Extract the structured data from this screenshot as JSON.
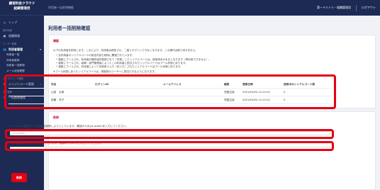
{
  "app": {
    "brand_line1": "顧客料金クラウド",
    "brand_line2": "組織管理用"
  },
  "topbar": {
    "breadcrumb": "利用者一括削除機能",
    "org_name": "第一ドミトリ・組織管理用",
    "logout": "ログアウト"
  },
  "sidebar": {
    "top": {
      "icon": "home-icon",
      "label": "トップ"
    },
    "section_basic": "基本情報",
    "basic_info": {
      "icon": "building-icon",
      "label": "組織情報"
    },
    "section_user": "ユーザー管理",
    "user_manage": {
      "icon": "users-icon",
      "label": "利用者管理"
    },
    "sub_items": [
      "利用者一覧",
      "利用者登録",
      "利用者一括登録",
      "メール送信履歴"
    ],
    "section_serial": "シリアルコード管理",
    "serial": {
      "icon": "key-icon",
      "label": "シリアルコード管理"
    },
    "section_log": "ログ管理",
    "log": {
      "icon": "list-icon",
      "label": "一括削除履歴"
    }
  },
  "page": {
    "title": "利用者一括削除確認"
  },
  "notice": {
    "heading": "確認",
    "intro": "以下の利用者を削除します。これにより、利用者は削除され、二度とログインできなくなります。この操作は取り消せません。",
    "bullets": [
      "全利用者のシリアルコードの設定内容も削除に関連されています。",
      "複数にブールされ、利用者が最終保存登録されて「状態」したシリアルコードは、使用済みのままとなります（再利用できません）。",
      "複数にブールされ、組織・部門管理者によってこの利用者に割当されたシリアルコードはプール状態に戻ります。",
      "複数にブールされ、利用者によって未使用で入力（未入力）されたシリアルコードはプール状態に戻ります。"
    ],
    "footnote": "※プール状態に戻ったシリアルコードは、再度別のユーザーに割当できるようになります。"
  },
  "table": {
    "headers": [
      "部門名",
      "氏名",
      "ログインID",
      "メールアドレス",
      "権限",
      "登録日時",
      "使用中のシリアルコード数"
    ],
    "rows": [
      [
        "発言力部門",
        "山田　太郎",
        "",
        "",
        "児童生徒",
        "2021/03/04 11:21:01",
        "0"
      ],
      [
        "発言力部門",
        "佐藤　花子",
        "",
        "",
        "児童生徒",
        "2021/03/04 11:21:01",
        "0"
      ]
    ]
  },
  "form": {
    "heading": "削除",
    "name_label": "yrt-admin(管理)から利用者を削除しようとしています。確認のためyrt-adminを入力してください。",
    "name_placeholder": "yrt-admin",
    "password_label": "(2人の利用者を削除しようとしています。確認のため2人を入力してください)",
    "password_placeholder": "",
    "submit": "削除"
  }
}
